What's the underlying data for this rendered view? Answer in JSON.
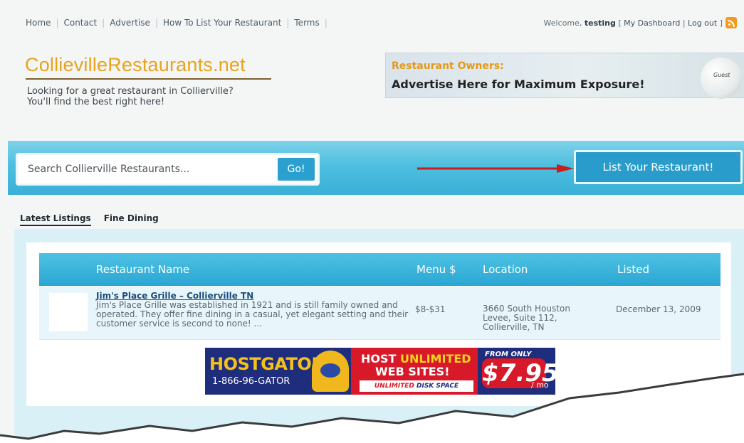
{
  "topnav": {
    "items": [
      "Home",
      "Contact",
      "Advertise",
      "How To List Your Restaurant",
      "Terms"
    ]
  },
  "user": {
    "welcome_prefix": "Welcome, ",
    "username": "testing",
    "dashboard_link": "My Dashboard",
    "logout_link": "Log out",
    "open_bracket": "[ ",
    "divider": " | ",
    "close_bracket": " ]"
  },
  "site": {
    "logo": "CollievilleRestaurants.net",
    "tagline_line1": "Looking for a great restaurant in Collierville?",
    "tagline_line2": "You'll find the best right here!"
  },
  "ad_banner": {
    "line1": "Restaurant Owners:",
    "line2": "Advertise Here for Maximum Exposure!",
    "badge": "Guest"
  },
  "search": {
    "placeholder": "Search Collierville Restaurants...",
    "go_label": "Go!"
  },
  "cta": {
    "list_label": "List Your Restaurant!"
  },
  "tabs": [
    "Latest Listings",
    "Fine Dining"
  ],
  "table": {
    "headers": [
      "Restaurant Name",
      "Menu $",
      "Location",
      "Listed"
    ],
    "rows": [
      {
        "name": "Jim's Place Grille – Collierville TN",
        "description": "Jim's Place Grille was established in 1921 and is still family owned and operated. They offer fine dining in a casual, yet elegant setting and their customer service is second to none! ...",
        "menu": "$8-$31",
        "location": "3660 South Houston Levee, Suite 112, Collierville, TN",
        "listed": "December 13, 2009"
      }
    ]
  },
  "promo": {
    "brand": "HOSTGATOR",
    "phone": "1-866-96-GATOR",
    "headline_a": "HOST ",
    "headline_b": "UNLIMITED",
    "headline_c": "WEB SITES!",
    "disk_a": "UNLIMITED ",
    "disk_b": "DISK SPACE",
    "from": "FROM ONLY",
    "price": "$7.95",
    "per": "/ mo"
  },
  "colors": {
    "accent_blue": "#2aa6d3",
    "logo_orange": "#e8a31c",
    "arrow_red": "#c91c1c"
  }
}
